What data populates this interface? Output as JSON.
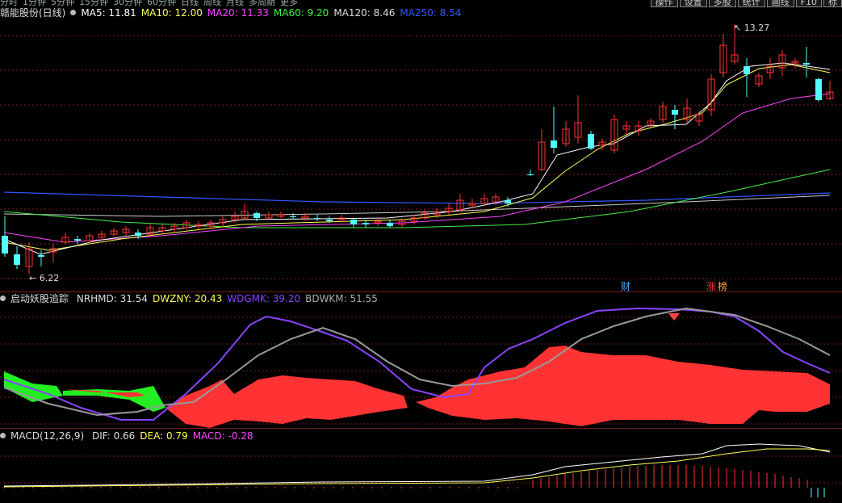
{
  "menu": {
    "items": [
      "分时",
      "1分钟",
      "5分钟",
      "15分钟",
      "30分钟",
      "60分钟",
      "日线",
      "周线",
      "月线",
      "多周期",
      "更多"
    ],
    "right_buttons": [
      "操作",
      "设置",
      "多股",
      "统计",
      "画线",
      "F10",
      "标"
    ]
  },
  "main_panel": {
    "title": "赣能股份(日线)",
    "indicators": [
      {
        "label": "MA5: 11.81",
        "color": "#ffffff"
      },
      {
        "label": "MA10: 12.00",
        "color": "#ffff55"
      },
      {
        "label": "MA20: 11.33",
        "color": "#ff44ff"
      },
      {
        "label": "MA60: 9.20",
        "color": "#44ee44"
      },
      {
        "label": "MA120: 8.46",
        "color": "#dddddd"
      },
      {
        "label": "MA250: 8.54",
        "color": "#3355ff"
      }
    ],
    "high_label": "13.27",
    "low_label": "6.22",
    "event_badges": [
      {
        "text": "财",
        "color": "#44aaff"
      },
      {
        "text": "涨",
        "color": "#ff3333"
      },
      {
        "text": "榜",
        "color": "#ffaa33"
      }
    ]
  },
  "indicator_panel": {
    "title": "启动妖股追踪",
    "values": [
      {
        "label": "NRHMD: 31.54",
        "color": "#dddddd"
      },
      {
        "label": "DWZNY: 20.43",
        "color": "#ffff55"
      },
      {
        "label": "WDGMK: 39.20",
        "color": "#8844ff"
      },
      {
        "label": "BDWKM: 51.55",
        "color": "#aaaaaa"
      }
    ]
  },
  "macd_panel": {
    "title": "MACD(12,26,9)",
    "values": [
      {
        "label": "DIF: 0.66",
        "color": "#dddddd"
      },
      {
        "label": "DEA: 0.79",
        "color": "#ffff55"
      },
      {
        "label": "MACD: -0.28",
        "color": "#ff44ff"
      }
    ]
  },
  "colors": {
    "up": "#ff3333",
    "down": "#54fcfc",
    "grid": "#7a1d1d",
    "sep": "#7a1d1d"
  }
}
